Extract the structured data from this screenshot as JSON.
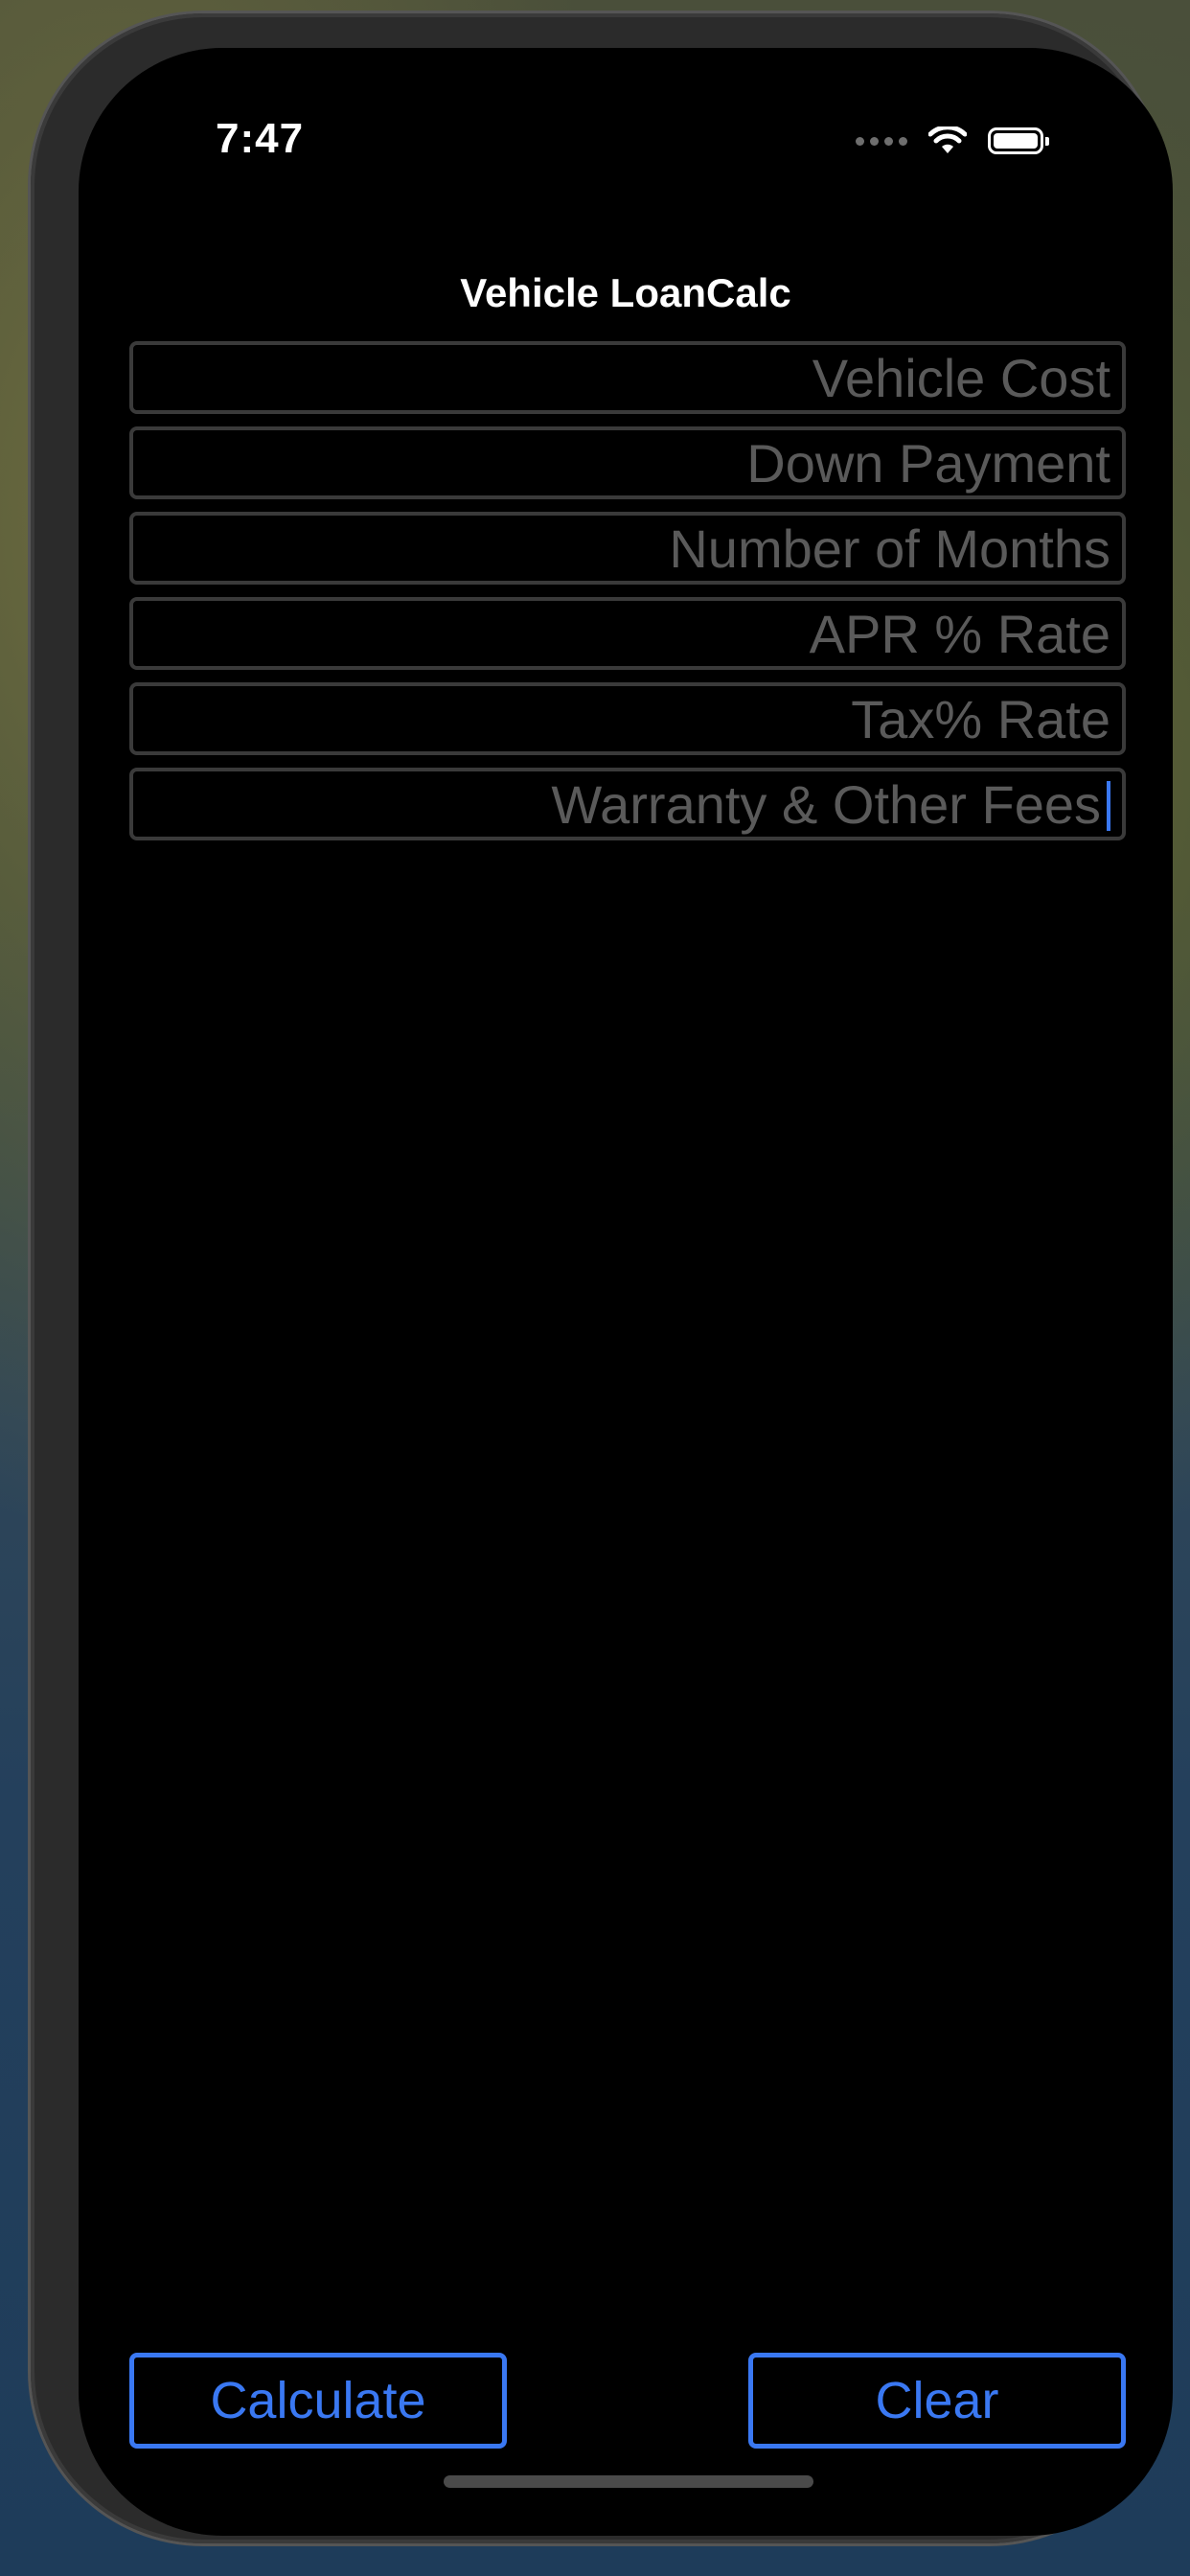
{
  "status_bar": {
    "time": "7:47",
    "signal_icon": "cellular-dots-icon",
    "wifi_icon": "wifi-icon",
    "battery_icon": "battery-icon"
  },
  "nav": {
    "title": "Vehicle LoanCalc"
  },
  "fields": [
    {
      "placeholder": "Vehicle Cost",
      "value": ""
    },
    {
      "placeholder": "Down Payment",
      "value": ""
    },
    {
      "placeholder": "Number of Months",
      "value": ""
    },
    {
      "placeholder": "APR % Rate",
      "value": ""
    },
    {
      "placeholder": "Tax% Rate",
      "value": ""
    },
    {
      "placeholder": "Warranty & Other Fees",
      "value": "",
      "focused": true
    }
  ],
  "buttons": {
    "calculate_label": "Calculate",
    "clear_label": "Clear"
  },
  "colors": {
    "accent": "#3a78f2",
    "background": "#000000",
    "placeholder": "#5a5a5a",
    "field_border": "#3a3a3a"
  }
}
